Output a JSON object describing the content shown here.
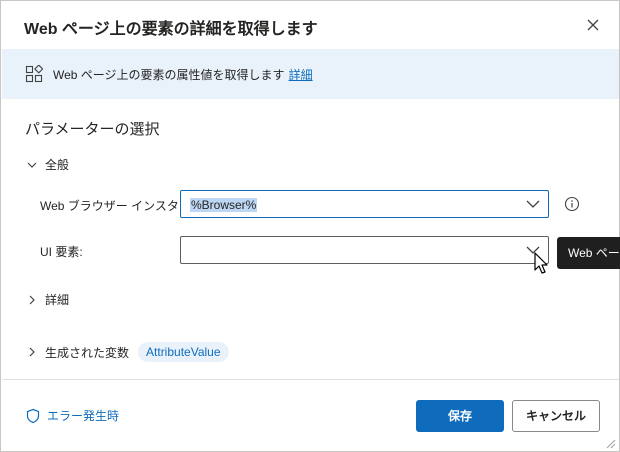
{
  "dialog": {
    "title": "Web ページ上の要素の詳細を取得します"
  },
  "banner": {
    "icon": "action-grid-icon",
    "text": "Web ページ上の要素の属性値を取得します",
    "link": "詳細"
  },
  "parameters": {
    "section_title": "パラメーターの選択",
    "general_group": "全般",
    "browser_label": "Web ブラウザー インスタンス:",
    "browser_value": "%Browser%",
    "ui_element_label": "UI 要素:",
    "ui_element_value": "",
    "tooltip_text": "Web ページ",
    "details_group": "詳細",
    "generated_vars_group": "生成された変数",
    "generated_var": "AttributeValue"
  },
  "footer": {
    "on_error": "エラー発生時",
    "save": "保存",
    "cancel": "キャンセル"
  },
  "colors": {
    "accent": "#0f6cbd",
    "banner_bg": "#e9f2fb",
    "selection": "#bcd6f3"
  }
}
